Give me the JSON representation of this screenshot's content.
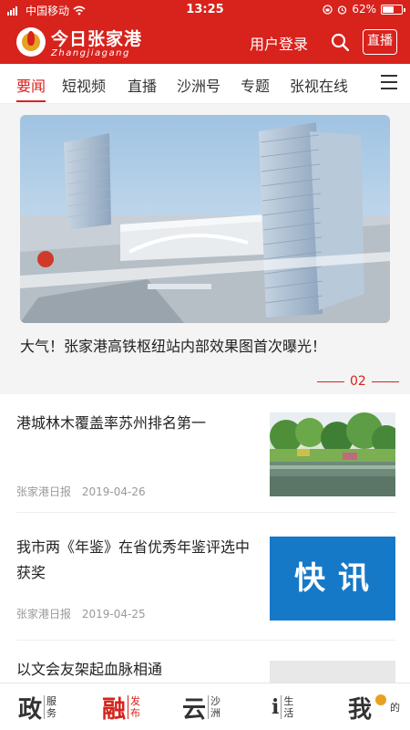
{
  "status_bar": {
    "carrier": "中国移动",
    "time": "13:25",
    "battery": "62%",
    "battery_level": 0.62
  },
  "header": {
    "logo_cn": "今日张家港",
    "logo_en": "Zhangjiagang",
    "login_label": "用户登录",
    "search_icon": "search-icon",
    "live_label": "直播"
  },
  "tabs": [
    {
      "label": "要闻",
      "active": true
    },
    {
      "label": "短视频"
    },
    {
      "label": "直播"
    },
    {
      "label": "沙洲号"
    },
    {
      "label": "专题"
    },
    {
      "label": "张视在线"
    }
  ],
  "hero": {
    "caption": "大气！张家港高铁枢纽站内部效果图首次曝光！",
    "page_indicator": "02"
  },
  "news": [
    {
      "title": "港城林木覆盖率苏州排名第一",
      "source": "张家港日报",
      "date": "2019-04-26",
      "thumb": "park-lake-photo"
    },
    {
      "title": "我市两《年鉴》在省优秀年鉴评选中获奖",
      "source": "张家港日报",
      "date": "2019-04-25",
      "thumb": "kuaixun-banner",
      "thumb_text": "快讯"
    },
    {
      "title": "以文会友架起血脉相通",
      "source": "",
      "date": "",
      "thumb": "placeholder"
    }
  ],
  "bottom_nav": [
    {
      "big": "政",
      "small": "服务",
      "active": false
    },
    {
      "big": "融",
      "small": "发布",
      "active": true
    },
    {
      "big": "云",
      "small": "沙洲",
      "active": false
    },
    {
      "big": "i",
      "small": "生活",
      "active": false
    },
    {
      "big": "我",
      "small": "的",
      "active": false
    }
  ],
  "colors": {
    "brand_red": "#d8221c",
    "kuaixun_blue": "#1679c8"
  }
}
